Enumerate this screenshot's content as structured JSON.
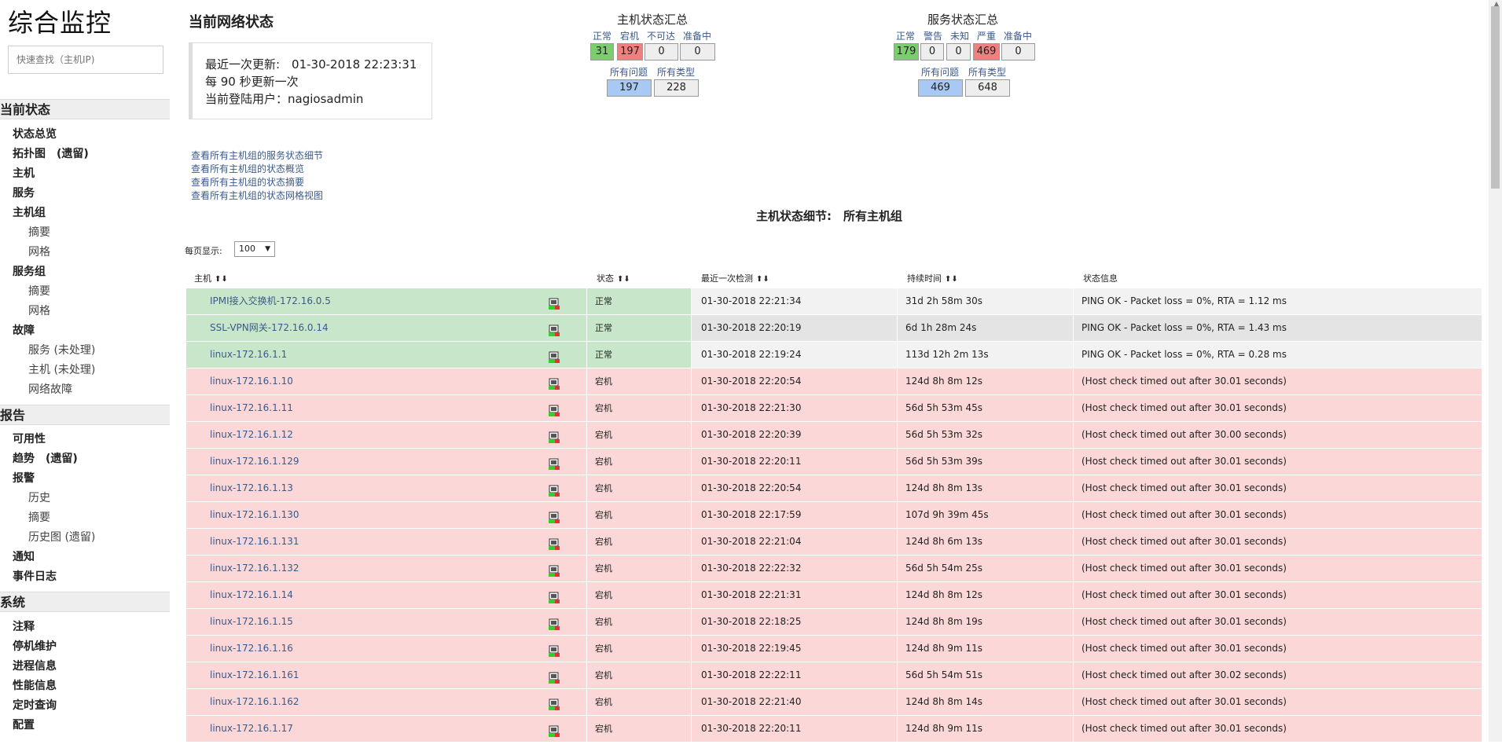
{
  "app": {
    "title": "综合监控"
  },
  "search": {
    "placeholder": "快速查找（主机IP)"
  },
  "sidebar": {
    "sections": [
      {
        "label": "当前状态"
      },
      {
        "label": "报告"
      },
      {
        "label": "系统"
      }
    ],
    "items": [
      {
        "label": "状态总览"
      },
      {
        "label": "拓扑图　(遗留)"
      },
      {
        "label": "主机"
      },
      {
        "label": "服务"
      },
      {
        "label": "主机组"
      },
      {
        "label": "摘要"
      },
      {
        "label": "网格"
      },
      {
        "label": "服务组"
      },
      {
        "label": "摘要"
      },
      {
        "label": "网格"
      },
      {
        "label": "故障"
      },
      {
        "label": "服务 (未处理)"
      },
      {
        "label": "主机 (未处理)"
      },
      {
        "label": "网络故障"
      },
      {
        "label": "可用性"
      },
      {
        "label": "趋势　(遗留)"
      },
      {
        "label": "报警"
      },
      {
        "label": "历史"
      },
      {
        "label": "摘要"
      },
      {
        "label": "历史图 (遗留)"
      },
      {
        "label": "通知"
      },
      {
        "label": "事件日志"
      },
      {
        "label": "注释"
      },
      {
        "label": "停机维护"
      },
      {
        "label": "进程信息"
      },
      {
        "label": "性能信息"
      },
      {
        "label": "定时查询"
      },
      {
        "label": "配置"
      }
    ]
  },
  "header": {
    "title": "当前网络状态",
    "last_update": "最近一次更新:　01-30-2018 22:23:31",
    "refresh": "每 90 秒更新一次",
    "user": "当前登陆用户：nagiosadmin"
  },
  "host_summary": {
    "title": "主机状态汇总",
    "labels": [
      "正常",
      "宕机",
      "不可达",
      "准备中"
    ],
    "values": [
      "31",
      "197",
      "0",
      "0"
    ],
    "total_labels": [
      "所有问题",
      "所有类型"
    ],
    "totals": [
      "197",
      "228"
    ]
  },
  "service_summary": {
    "title": "服务状态汇总",
    "labels": [
      "正常",
      "警告",
      "未知",
      "严重",
      "准备中"
    ],
    "values": [
      "179",
      "0",
      "0",
      "469",
      "0"
    ],
    "total_labels": [
      "所有问题",
      "所有类型"
    ],
    "totals": [
      "469",
      "648"
    ]
  },
  "links": [
    "查看所有主机组的服务状态细节",
    "查看所有主机组的状态概览",
    "查看所有主机组的状态摘要",
    "查看所有主机组的状态网格视图"
  ],
  "detail_title": "主机状态细节:　所有主机组",
  "page_size": {
    "label": "每页显示:",
    "value": "100"
  },
  "table": {
    "headers": [
      "主机",
      "状态",
      "最近一次检测",
      "持续时间",
      "状态信息"
    ],
    "rows": [
      {
        "host": "IPMI接入交换机-172.16.0.5",
        "status": "正常",
        "last": "01-30-2018 22:21:34",
        "dur": "31d 2h 58m 30s",
        "info": "PING OK - Packet loss = 0%, RTA = 1.12 ms"
      },
      {
        "host": "SSL-VPN网关-172.16.0.14",
        "status": "正常",
        "last": "01-30-2018 22:20:19",
        "dur": "6d 1h 28m 24s",
        "info": "PING OK - Packet loss = 0%, RTA = 1.43 ms"
      },
      {
        "host": "linux-172.16.1.1",
        "status": "正常",
        "last": "01-30-2018 22:19:24",
        "dur": "113d 12h 2m 13s",
        "info": "PING OK - Packet loss = 0%, RTA = 0.28 ms"
      },
      {
        "host": "linux-172.16.1.10",
        "status": "宕机",
        "last": "01-30-2018 22:20:54",
        "dur": "124d 8h 8m 12s",
        "info": "(Host check timed out after 30.01 seconds)"
      },
      {
        "host": "linux-172.16.1.11",
        "status": "宕机",
        "last": "01-30-2018 22:21:30",
        "dur": "56d 5h 53m 45s",
        "info": "(Host check timed out after 30.01 seconds)"
      },
      {
        "host": "linux-172.16.1.12",
        "status": "宕机",
        "last": "01-30-2018 22:20:39",
        "dur": "56d 5h 53m 32s",
        "info": "(Host check timed out after 30.00 seconds)"
      },
      {
        "host": "linux-172.16.1.129",
        "status": "宕机",
        "last": "01-30-2018 22:20:11",
        "dur": "56d 5h 53m 39s",
        "info": "(Host check timed out after 30.01 seconds)"
      },
      {
        "host": "linux-172.16.1.13",
        "status": "宕机",
        "last": "01-30-2018 22:20:54",
        "dur": "124d 8h 8m 13s",
        "info": "(Host check timed out after 30.01 seconds)"
      },
      {
        "host": "linux-172.16.1.130",
        "status": "宕机",
        "last": "01-30-2018 22:17:59",
        "dur": "107d 9h 39m 45s",
        "info": "(Host check timed out after 30.01 seconds)"
      },
      {
        "host": "linux-172.16.1.131",
        "status": "宕机",
        "last": "01-30-2018 22:21:04",
        "dur": "124d 8h 6m 13s",
        "info": "(Host check timed out after 30.01 seconds)"
      },
      {
        "host": "linux-172.16.1.132",
        "status": "宕机",
        "last": "01-30-2018 22:22:32",
        "dur": "56d 5h 54m 25s",
        "info": "(Host check timed out after 30.01 seconds)"
      },
      {
        "host": "linux-172.16.1.14",
        "status": "宕机",
        "last": "01-30-2018 22:21:31",
        "dur": "124d 8h 8m 12s",
        "info": "(Host check timed out after 30.01 seconds)"
      },
      {
        "host": "linux-172.16.1.15",
        "status": "宕机",
        "last": "01-30-2018 22:18:25",
        "dur": "124d 8h 8m 19s",
        "info": "(Host check timed out after 30.01 seconds)"
      },
      {
        "host": "linux-172.16.1.16",
        "status": "宕机",
        "last": "01-30-2018 22:19:45",
        "dur": "124d 8h 9m 11s",
        "info": "(Host check timed out after 30.01 seconds)"
      },
      {
        "host": "linux-172.16.1.161",
        "status": "宕机",
        "last": "01-30-2018 22:22:11",
        "dur": "56d 5h 54m 51s",
        "info": "(Host check timed out after 30.02 seconds)"
      },
      {
        "host": "linux-172.16.1.162",
        "status": "宕机",
        "last": "01-30-2018 22:21:40",
        "dur": "124d 8h 8m 14s",
        "info": "(Host check timed out after 30.01 seconds)"
      },
      {
        "host": "linux-172.16.1.17",
        "status": "宕机",
        "last": "01-30-2018 22:20:11",
        "dur": "124d 8h 9m 11s",
        "info": "(Host check timed out after 30.01 seconds)"
      }
    ]
  },
  "colors": {
    "up": "#c8e6c9",
    "down": "#fbd7d7",
    "ok_cell": "#7ccd6e",
    "crit_cell": "#f08080",
    "total_cell": "#a9c9f5"
  }
}
